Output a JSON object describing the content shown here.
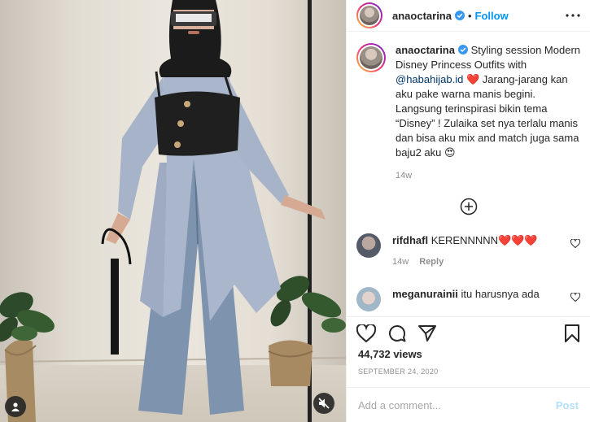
{
  "post": {
    "username": "anaoctarina",
    "follow_label": "Follow",
    "dot": "•",
    "caption_user": "anaoctarina",
    "caption_start": "Styling session Modern Disney Princess Outfits with",
    "caption_mention": "@habahijab.id",
    "caption_rest": "Jarang-jarang kan aku pake warna manis begini. Langsung terinspirasi bikin tema “Disney” ! Zulaika set nya terlalu manis dan bisa aku mix and match juga sama baju2 aku",
    "caption_emoji_1": "❤️",
    "caption_emoji_2": "😍",
    "caption_time": "14w"
  },
  "comments": [
    {
      "user": "rifdhafl",
      "text": "KERENNNNN",
      "emoji": "❤️❤️❤️",
      "time": "14w",
      "reply_label": "Reply"
    },
    {
      "user": "meganurainii",
      "text": "itu harusnya ada",
      "emoji": "",
      "time": "",
      "reply_label": ""
    }
  ],
  "stats": {
    "views": "44,732 views",
    "date": "SEPTEMBER 24, 2020"
  },
  "composer": {
    "placeholder": "Add a comment...",
    "post_label": "Post"
  },
  "colors": {
    "accent": "#0095f6",
    "post_disabled": "#b2dffc",
    "heart_red": "#ed4956",
    "hijab": "#1b1b1b",
    "dress": "#aab6cc",
    "jeans": "#7e93ad"
  },
  "icons": [
    "verified-icon",
    "more-options-icon",
    "load-more-icon",
    "like-icon",
    "comment-icon",
    "share-icon",
    "save-icon",
    "user-tag-icon",
    "mute-icon"
  ]
}
